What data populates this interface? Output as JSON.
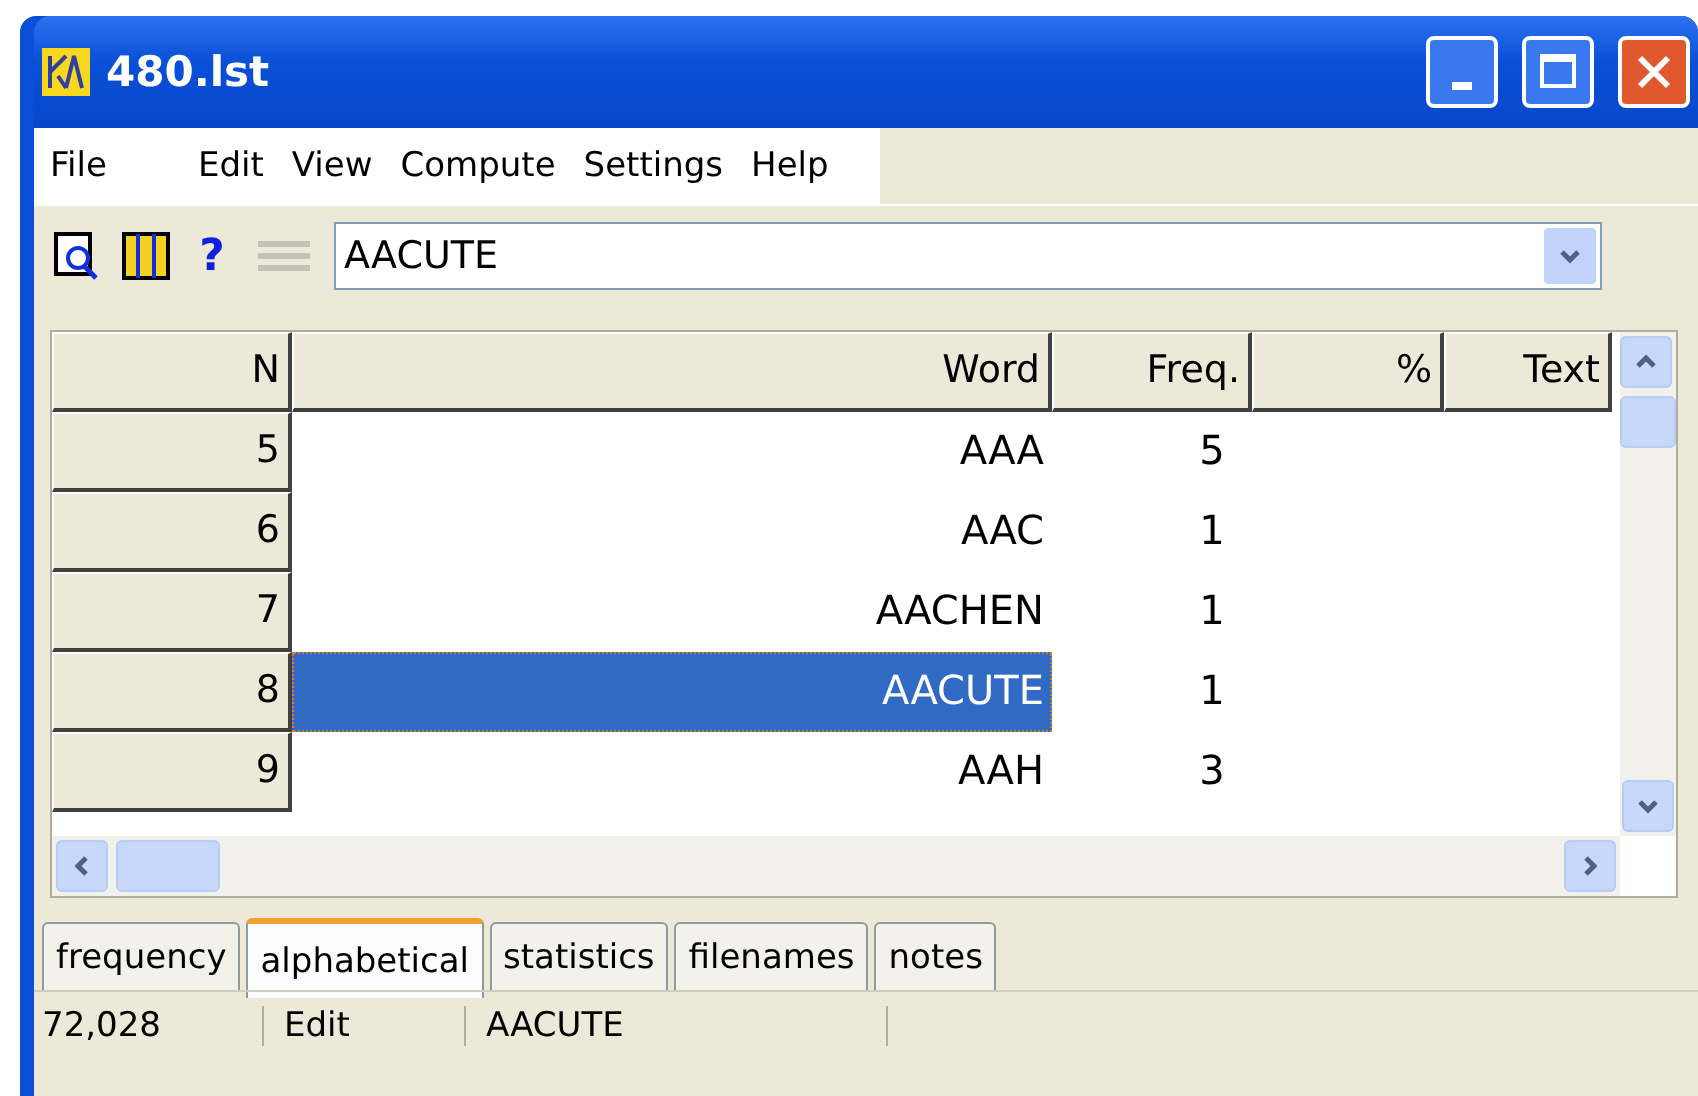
{
  "window": {
    "title": "480.lst"
  },
  "menu": [
    "File",
    "Edit",
    "View",
    "Compute",
    "Settings",
    "Help"
  ],
  "toolbar": {
    "help_glyph": "?",
    "list_disabled": true,
    "combo": {
      "value": "AACUTE"
    }
  },
  "table": {
    "columns": [
      "N",
      "Word",
      "Freq.",
      "%",
      "Text"
    ],
    "rows": [
      {
        "n": "5",
        "word": "AAA",
        "freq": "5",
        "selected": false
      },
      {
        "n": "6",
        "word": "AAC",
        "freq": "1",
        "selected": false
      },
      {
        "n": "7",
        "word": "AACHEN",
        "freq": "1",
        "selected": false
      },
      {
        "n": "8",
        "word": "AACUTE",
        "freq": "1",
        "selected": true
      },
      {
        "n": "9",
        "word": "AAH",
        "freq": "3",
        "selected": false
      }
    ]
  },
  "tabs": [
    {
      "label": "frequency",
      "selected": false
    },
    {
      "label": "alphabetical",
      "selected": true
    },
    {
      "label": "statistics",
      "selected": false
    },
    {
      "label": "filenames",
      "selected": false
    },
    {
      "label": "notes",
      "selected": false
    }
  ],
  "status_bar": [
    "72,028",
    "Edit",
    "AACUTE"
  ]
}
